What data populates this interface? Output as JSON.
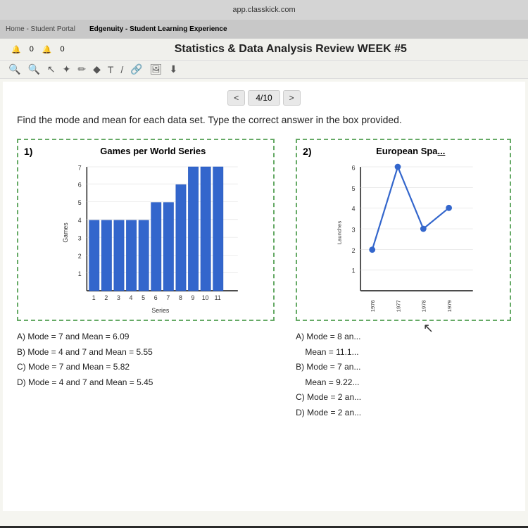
{
  "browser": {
    "url": "app.classkick.com",
    "tab1": "Home - Student Portal",
    "tab2": "Edgenuity - Student Learning Experience"
  },
  "app": {
    "title": "Statistics & Data Analysis Review WEEK #5",
    "nav": {
      "current": "4/10",
      "prev_label": "<",
      "next_label": ">"
    }
  },
  "question": {
    "text": "Find the mode and mean for each data set. Type the correct answer in the box provided."
  },
  "problem1": {
    "number": "1)",
    "chart_title": "Games per World Series",
    "x_label": "Series",
    "y_label": "Games",
    "bar_data": [
      4,
      4,
      4,
      4,
      4,
      5,
      5,
      6,
      7,
      7,
      7
    ],
    "x_values": [
      "1",
      "2",
      "3",
      "4",
      "5",
      "6",
      "7",
      "8",
      "9",
      "10",
      "11"
    ],
    "y_max": 7,
    "answers": {
      "A": "Mode = 7 and Mean = 6.09",
      "B": "Mode = 4 and 7 and Mean = 5.55",
      "C": "Mode = 7 and Mean = 5.82",
      "D": "Mode = 4 and 7 and Mean = 5.45"
    }
  },
  "problem2": {
    "number": "2)",
    "chart_title": "European Spa...",
    "x_label": "",
    "y_label": "Launches",
    "years": [
      "1976",
      "1977",
      "1978",
      "1979"
    ],
    "line_points": [
      2,
      6,
      3,
      4
    ],
    "y_max": 6,
    "answers": {
      "A": "Mode = 8 an... Mean = 11.1...",
      "B": "Mode = 7 an... Mean = 9.22...",
      "C": "Mode = 2 an...",
      "D": "Mode = 2 an..."
    }
  },
  "toolbar": {
    "icons": [
      "cursor",
      "hand",
      "pencil",
      "diamond",
      "T",
      "slash",
      "chain",
      "image",
      "down-arrow"
    ]
  }
}
